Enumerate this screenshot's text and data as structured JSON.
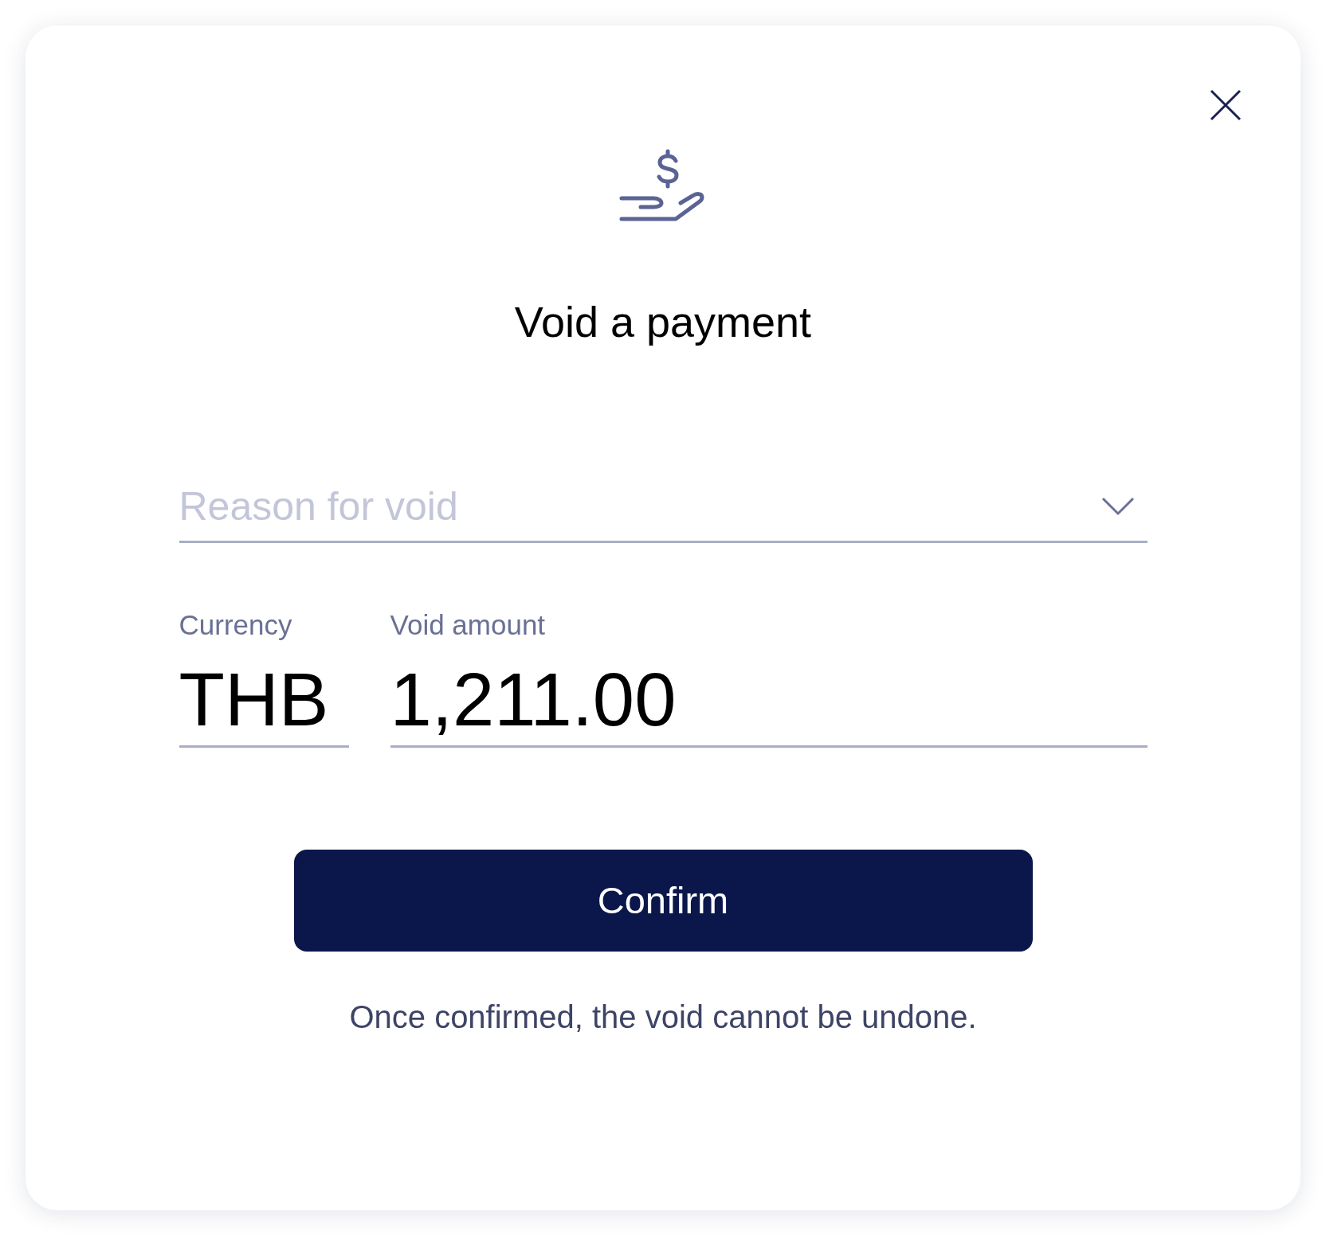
{
  "dialog": {
    "title": "Void a payment"
  },
  "reason_select": {
    "placeholder": "Reason for void"
  },
  "currency": {
    "label": "Currency",
    "value": "THB"
  },
  "amount": {
    "label": "Void amount",
    "value": "1,211.00"
  },
  "confirm_button": {
    "label": "Confirm"
  },
  "note": "Once confirmed, the void cannot be undone."
}
